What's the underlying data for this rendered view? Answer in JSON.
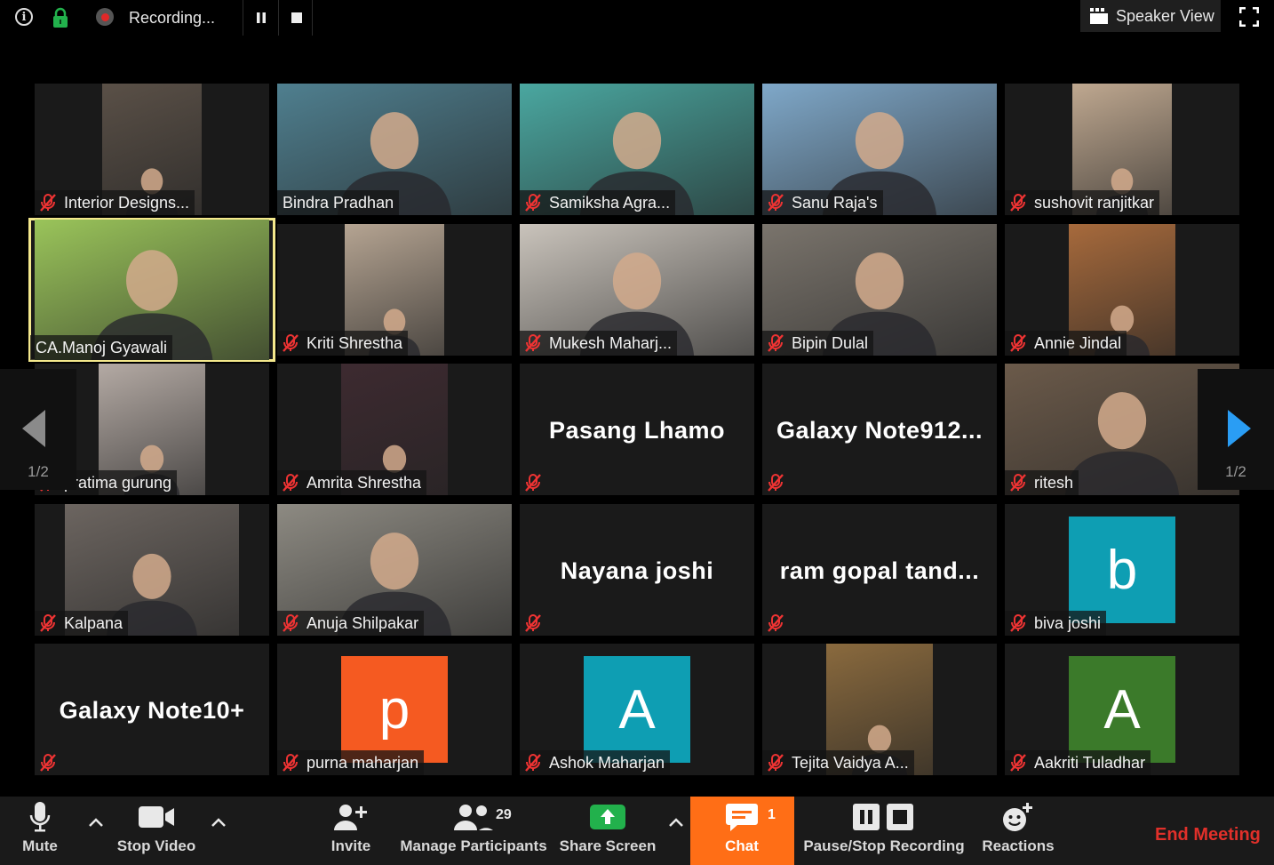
{
  "topbar": {
    "recording_label": "Recording...",
    "speaker_view_label": "Speaker View"
  },
  "pagination": {
    "left": "1/2",
    "right": "1/2"
  },
  "participants": [
    {
      "name": "Interior Designs...",
      "muted": true,
      "bg": "#5a5047",
      "photo": true
    },
    {
      "name": "Bindra Pradhan",
      "muted": false,
      "bg": "#4f7f8f",
      "photo": true
    },
    {
      "name": "Samiksha Agra...",
      "muted": true,
      "bg": "#4aa7a0",
      "photo": true
    },
    {
      "name": "Sanu Raja's",
      "muted": true,
      "bg": "#7fa8c9",
      "photo": true
    },
    {
      "name": "sushovit ranjitkar",
      "muted": true,
      "bg": "#bfa890",
      "photo": true
    },
    {
      "name": "CA.Manoj Gyawali",
      "muted": false,
      "bg": "#9ac45a",
      "photo": true
    },
    {
      "name": "Kriti Shrestha",
      "muted": true,
      "bg": "#b5a492",
      "photo": true
    },
    {
      "name": "Mukesh Maharj...",
      "muted": true,
      "bg": "#c9c3bb",
      "photo": true
    },
    {
      "name": "Bipin Dulal",
      "muted": true,
      "bg": "#7a746c",
      "photo": true
    },
    {
      "name": "Annie Jindal",
      "muted": true,
      "bg": "#a76a3c",
      "photo": true
    },
    {
      "name": "pratima gurung",
      "muted": true,
      "bg": "#b4aaa4",
      "photo": true
    },
    {
      "name": "Amrita Shrestha",
      "muted": true,
      "bg": "#3d2a30",
      "photo": true
    },
    {
      "name": "Pasang Lhamo",
      "muted": true,
      "photo": false
    },
    {
      "name": "Galaxy  Note912...",
      "muted": true,
      "photo": false
    },
    {
      "name": "ritesh",
      "muted": true,
      "bg": "#6b5a4a",
      "photo": true
    },
    {
      "name": "Kalpana",
      "muted": true,
      "bg": "#6c6560",
      "photo": true
    },
    {
      "name": "Anuja Shilpakar",
      "muted": true,
      "bg": "#8d8a82",
      "photo": true
    },
    {
      "name": "Nayana joshi",
      "muted": true,
      "photo": false
    },
    {
      "name": "ram  gopal  tand...",
      "muted": true,
      "photo": false
    },
    {
      "name": "biva joshi",
      "muted": true,
      "avatar": "b",
      "avatar_color": "#0e9eb3"
    },
    {
      "name": "Galaxy Note10+",
      "muted": true,
      "photo": false
    },
    {
      "name": "purna maharjan",
      "muted": true,
      "avatar": "p",
      "avatar_color": "#f55a21"
    },
    {
      "name": "Ashok Maharjan",
      "muted": true,
      "avatar": "A",
      "avatar_color": "#0e9eb3"
    },
    {
      "name": "Tejita Vaidya A...",
      "muted": true,
      "bg": "#8a6a3e",
      "photo": true
    },
    {
      "name": "Aakriti Tuladhar",
      "muted": true,
      "avatar": "A",
      "avatar_color": "#3b7a2a"
    }
  ],
  "toolbar": {
    "mute": "Mute",
    "stop_video": "Stop Video",
    "invite": "Invite",
    "manage_participants": "Manage Participants",
    "participant_count": "29",
    "share_screen": "Share Screen",
    "chat": "Chat",
    "chat_badge": "1",
    "pause_stop_recording": "Pause/Stop Recording",
    "reactions": "Reactions",
    "end_meeting": "End Meeting"
  },
  "colors": {
    "accent_chat": "#ff6e16",
    "share_green": "#22b14c",
    "end_red": "#e0302a",
    "active_speaker": "#f4e88c"
  }
}
